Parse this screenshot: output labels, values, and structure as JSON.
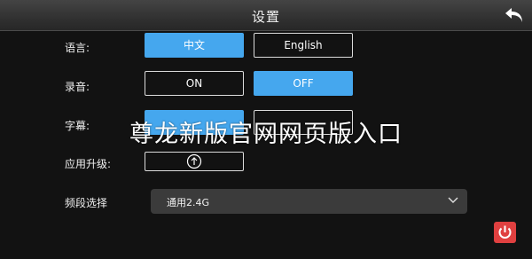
{
  "header": {
    "title": "设置",
    "back_icon": "back-arrow-icon"
  },
  "settings": {
    "language": {
      "label": "语言:",
      "options": [
        "中文",
        "English"
      ],
      "selected": "中文"
    },
    "recording": {
      "label": "录音:",
      "options": [
        "ON",
        "OFF"
      ],
      "selected": "OFF"
    },
    "subtitle": {
      "label": "字幕:"
    },
    "upgrade": {
      "label": "应用升级:",
      "icon": "upload-circle-icon"
    },
    "band": {
      "label": "频段选择",
      "value": "通用2.4G",
      "icon": "chevron-down-icon"
    }
  },
  "power": {
    "icon": "power-icon",
    "color": "#e04040"
  },
  "watermark": {
    "text": "尊龙新版官网网页版入口"
  },
  "colors": {
    "accent": "#45a7ee",
    "background": "#121212"
  }
}
